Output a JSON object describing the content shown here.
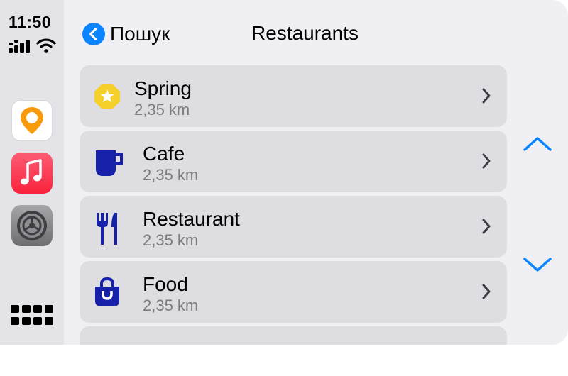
{
  "status": {
    "time": "11:50"
  },
  "sidebar": {
    "apps": [
      {
        "name": "maps-app",
        "icon": "map-pin-icon"
      },
      {
        "name": "music-app",
        "icon": "music-note-icon"
      },
      {
        "name": "settings-app",
        "icon": "gear-icon"
      }
    ],
    "launcher_icon": "grid-icon"
  },
  "header": {
    "back_label": "Пошук",
    "title": "Restaurants"
  },
  "list": {
    "items": [
      {
        "name": "Spring",
        "distance": "2,35 km",
        "icon": "star-badge-icon"
      },
      {
        "name": "Cafe",
        "distance": "2,35 km",
        "icon": "cup-icon"
      },
      {
        "name": "Restaurant",
        "distance": "2,35 km",
        "icon": "fork-knife-icon"
      },
      {
        "name": "Food",
        "distance": "2,35 km",
        "icon": "shopping-bag-icon"
      },
      {
        "name": "",
        "distance": "",
        "icon": ""
      }
    ]
  },
  "colors": {
    "accent": "#0a84ff",
    "category_icon": "#1720a8",
    "star_badge": "#f5d02b"
  }
}
